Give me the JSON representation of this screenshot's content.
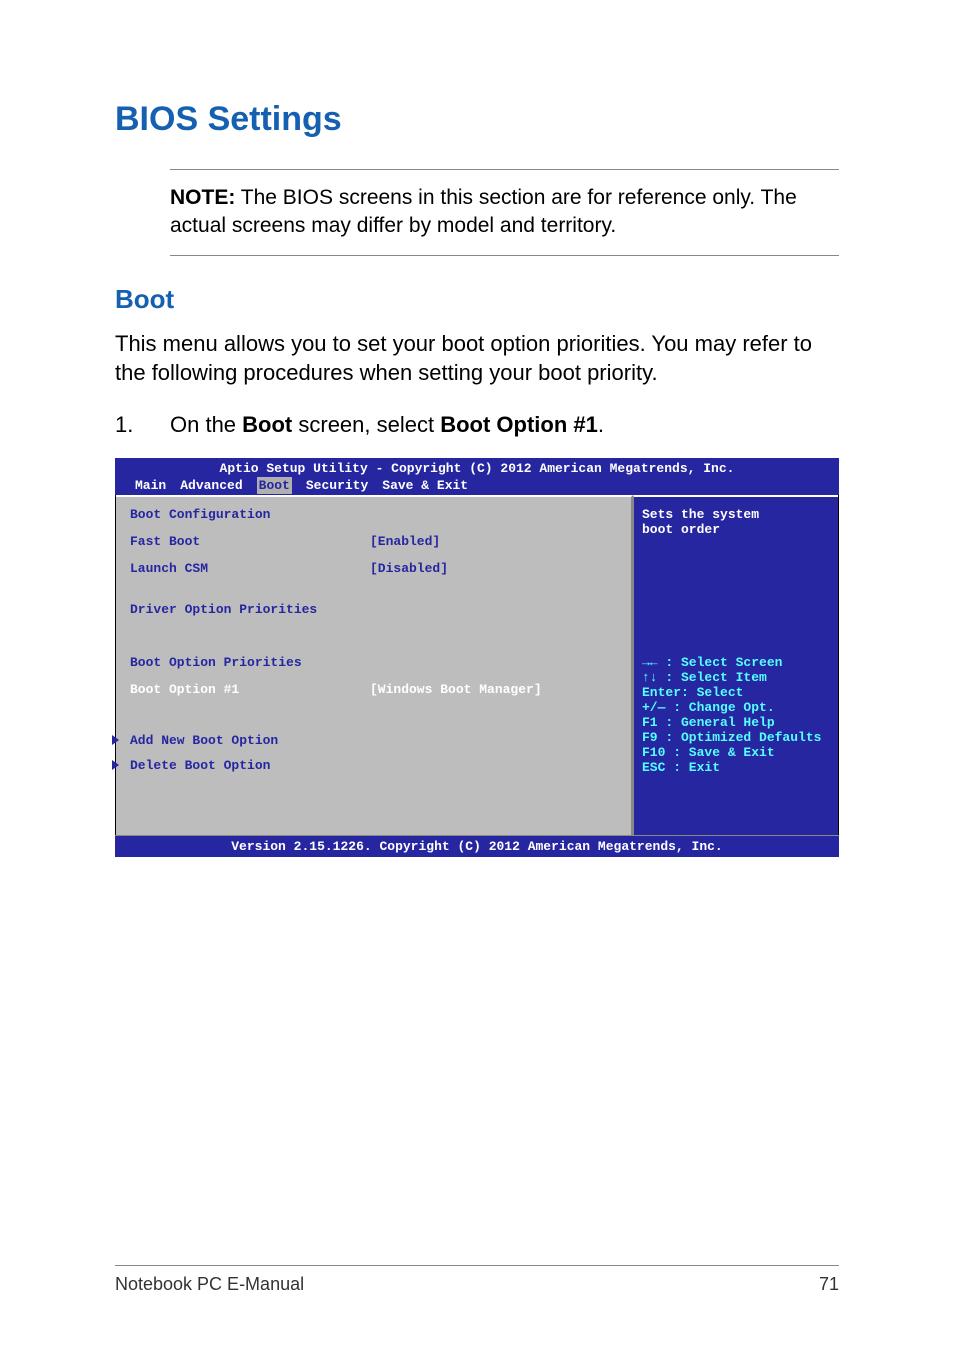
{
  "heading_main": "BIOS Settings",
  "note_label": "NOTE:",
  "note_text": " The BIOS screens in this section are for reference only. The actual screens may differ by model and territory.",
  "heading_sub": "Boot",
  "intro_text": "This menu allows you to set your boot option priorities. You may refer to the following procedures when setting your boot priority.",
  "step_num": "1.",
  "step_pre": "On the ",
  "step_b1": "Boot",
  "step_mid": " screen, select ",
  "step_b2": "Boot Option #1",
  "step_post": ".",
  "bios": {
    "title": "Aptio Setup Utility - Copyright (C) 2012 American Megatrends, Inc.",
    "tabs": {
      "main": "Main",
      "advanced": "Advanced",
      "boot": "Boot",
      "security": "Security",
      "save_exit": "Save & Exit"
    },
    "left": {
      "boot_config": "Boot Configuration",
      "fast_boot_label": "Fast Boot",
      "fast_boot_value": "[Enabled]",
      "launch_csm_label": "Launch CSM",
      "launch_csm_value": "[Disabled]",
      "driver_prio": "Driver Option Priorities",
      "boot_prio": "Boot Option Priorities",
      "boot_opt1_label": "Boot Option #1",
      "boot_opt1_value": "[Windows Boot Manager]",
      "add_new": "Add New Boot Option",
      "delete_opt": "Delete Boot Option"
    },
    "right": {
      "desc1": "Sets the system",
      "desc2": "boot order",
      "h1": "→←  : Select Screen",
      "h2": "↑↓  : Select Item",
      "h3": "Enter: Select",
      "h4": "+/—  : Change Opt.",
      "h5": "F1   : General Help",
      "h6": "F9   : Optimized Defaults",
      "h7": "F10  : Save & Exit",
      "h8": "ESC  : Exit"
    },
    "footer": "Version 2.15.1226. Copyright (C) 2012 American Megatrends, Inc."
  },
  "footer_left": "Notebook PC E-Manual",
  "footer_right": "71"
}
